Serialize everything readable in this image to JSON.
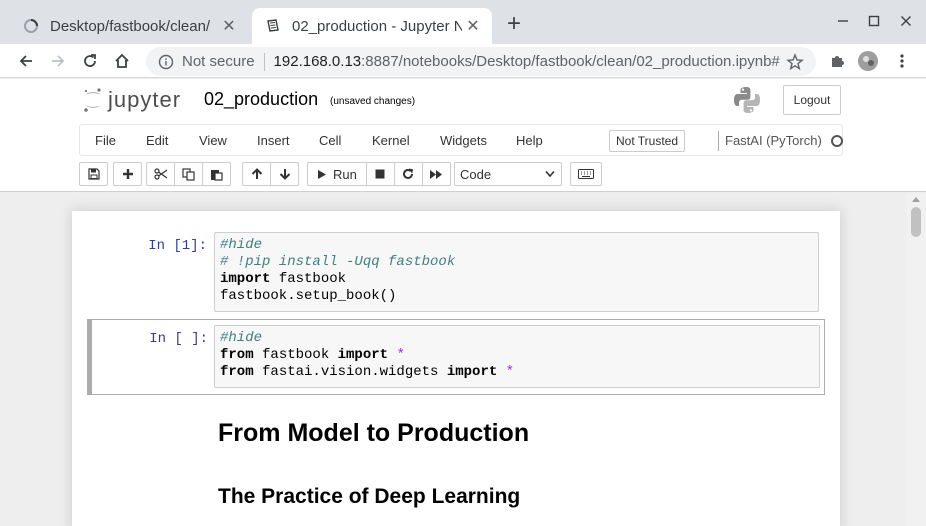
{
  "browser": {
    "tabs": [
      {
        "title": "Desktop/fastbook/clean/",
        "active": false,
        "icon": "loading-spinner-icon"
      },
      {
        "title": "02_production - Jupyter N",
        "active": true,
        "icon": "notebook-icon"
      }
    ],
    "new_tab_label": "+",
    "address": {
      "security_label": "Not secure",
      "host": "192.168.0.13",
      "path": ":8887/notebooks/Desktop/fastbook/clean/02_production.ipynb#"
    }
  },
  "jupyter": {
    "logo_text": "jupyter",
    "notebook_name": "02_production",
    "save_status": "(unsaved changes)",
    "logout_label": "Logout",
    "menus": [
      "File",
      "Edit",
      "View",
      "Insert",
      "Cell",
      "Kernel",
      "Widgets",
      "Help"
    ],
    "trust_label": "Not Trusted",
    "kernel_name": "FastAI (PyTorch)",
    "run_label": "Run",
    "cell_type": "Code"
  },
  "cells": [
    {
      "prompt": "In [1]:",
      "lines": [
        [
          {
            "t": "#hide",
            "c": "comment"
          }
        ],
        [
          {
            "t": "# !pip install -Uqq fastbook",
            "c": "comment"
          }
        ],
        [
          {
            "t": "import",
            "c": "kw"
          },
          {
            "t": " fastbook",
            "c": ""
          }
        ],
        [
          {
            "t": "fastbook.setup_book()",
            "c": ""
          }
        ]
      ]
    },
    {
      "prompt": "In [ ]:",
      "lines": [
        [
          {
            "t": "#hide",
            "c": "comment"
          }
        ],
        [
          {
            "t": "from",
            "c": "kw"
          },
          {
            "t": " fastbook ",
            "c": ""
          },
          {
            "t": "import",
            "c": "kw"
          },
          {
            "t": " *",
            "c": "op"
          }
        ],
        [
          {
            "t": "from",
            "c": "kw"
          },
          {
            "t": " fastai.vision.widgets ",
            "c": ""
          },
          {
            "t": "import",
            "c": "kw"
          },
          {
            "t": " *",
            "c": "op"
          }
        ]
      ]
    }
  ],
  "markdown": {
    "h1": "From Model to Production",
    "h2": "The Practice of Deep Learning"
  },
  "colors": {
    "prompt": "#303f9f",
    "comment": "#408080",
    "operator": "#aa22ff",
    "selected_border": "#ababab"
  }
}
